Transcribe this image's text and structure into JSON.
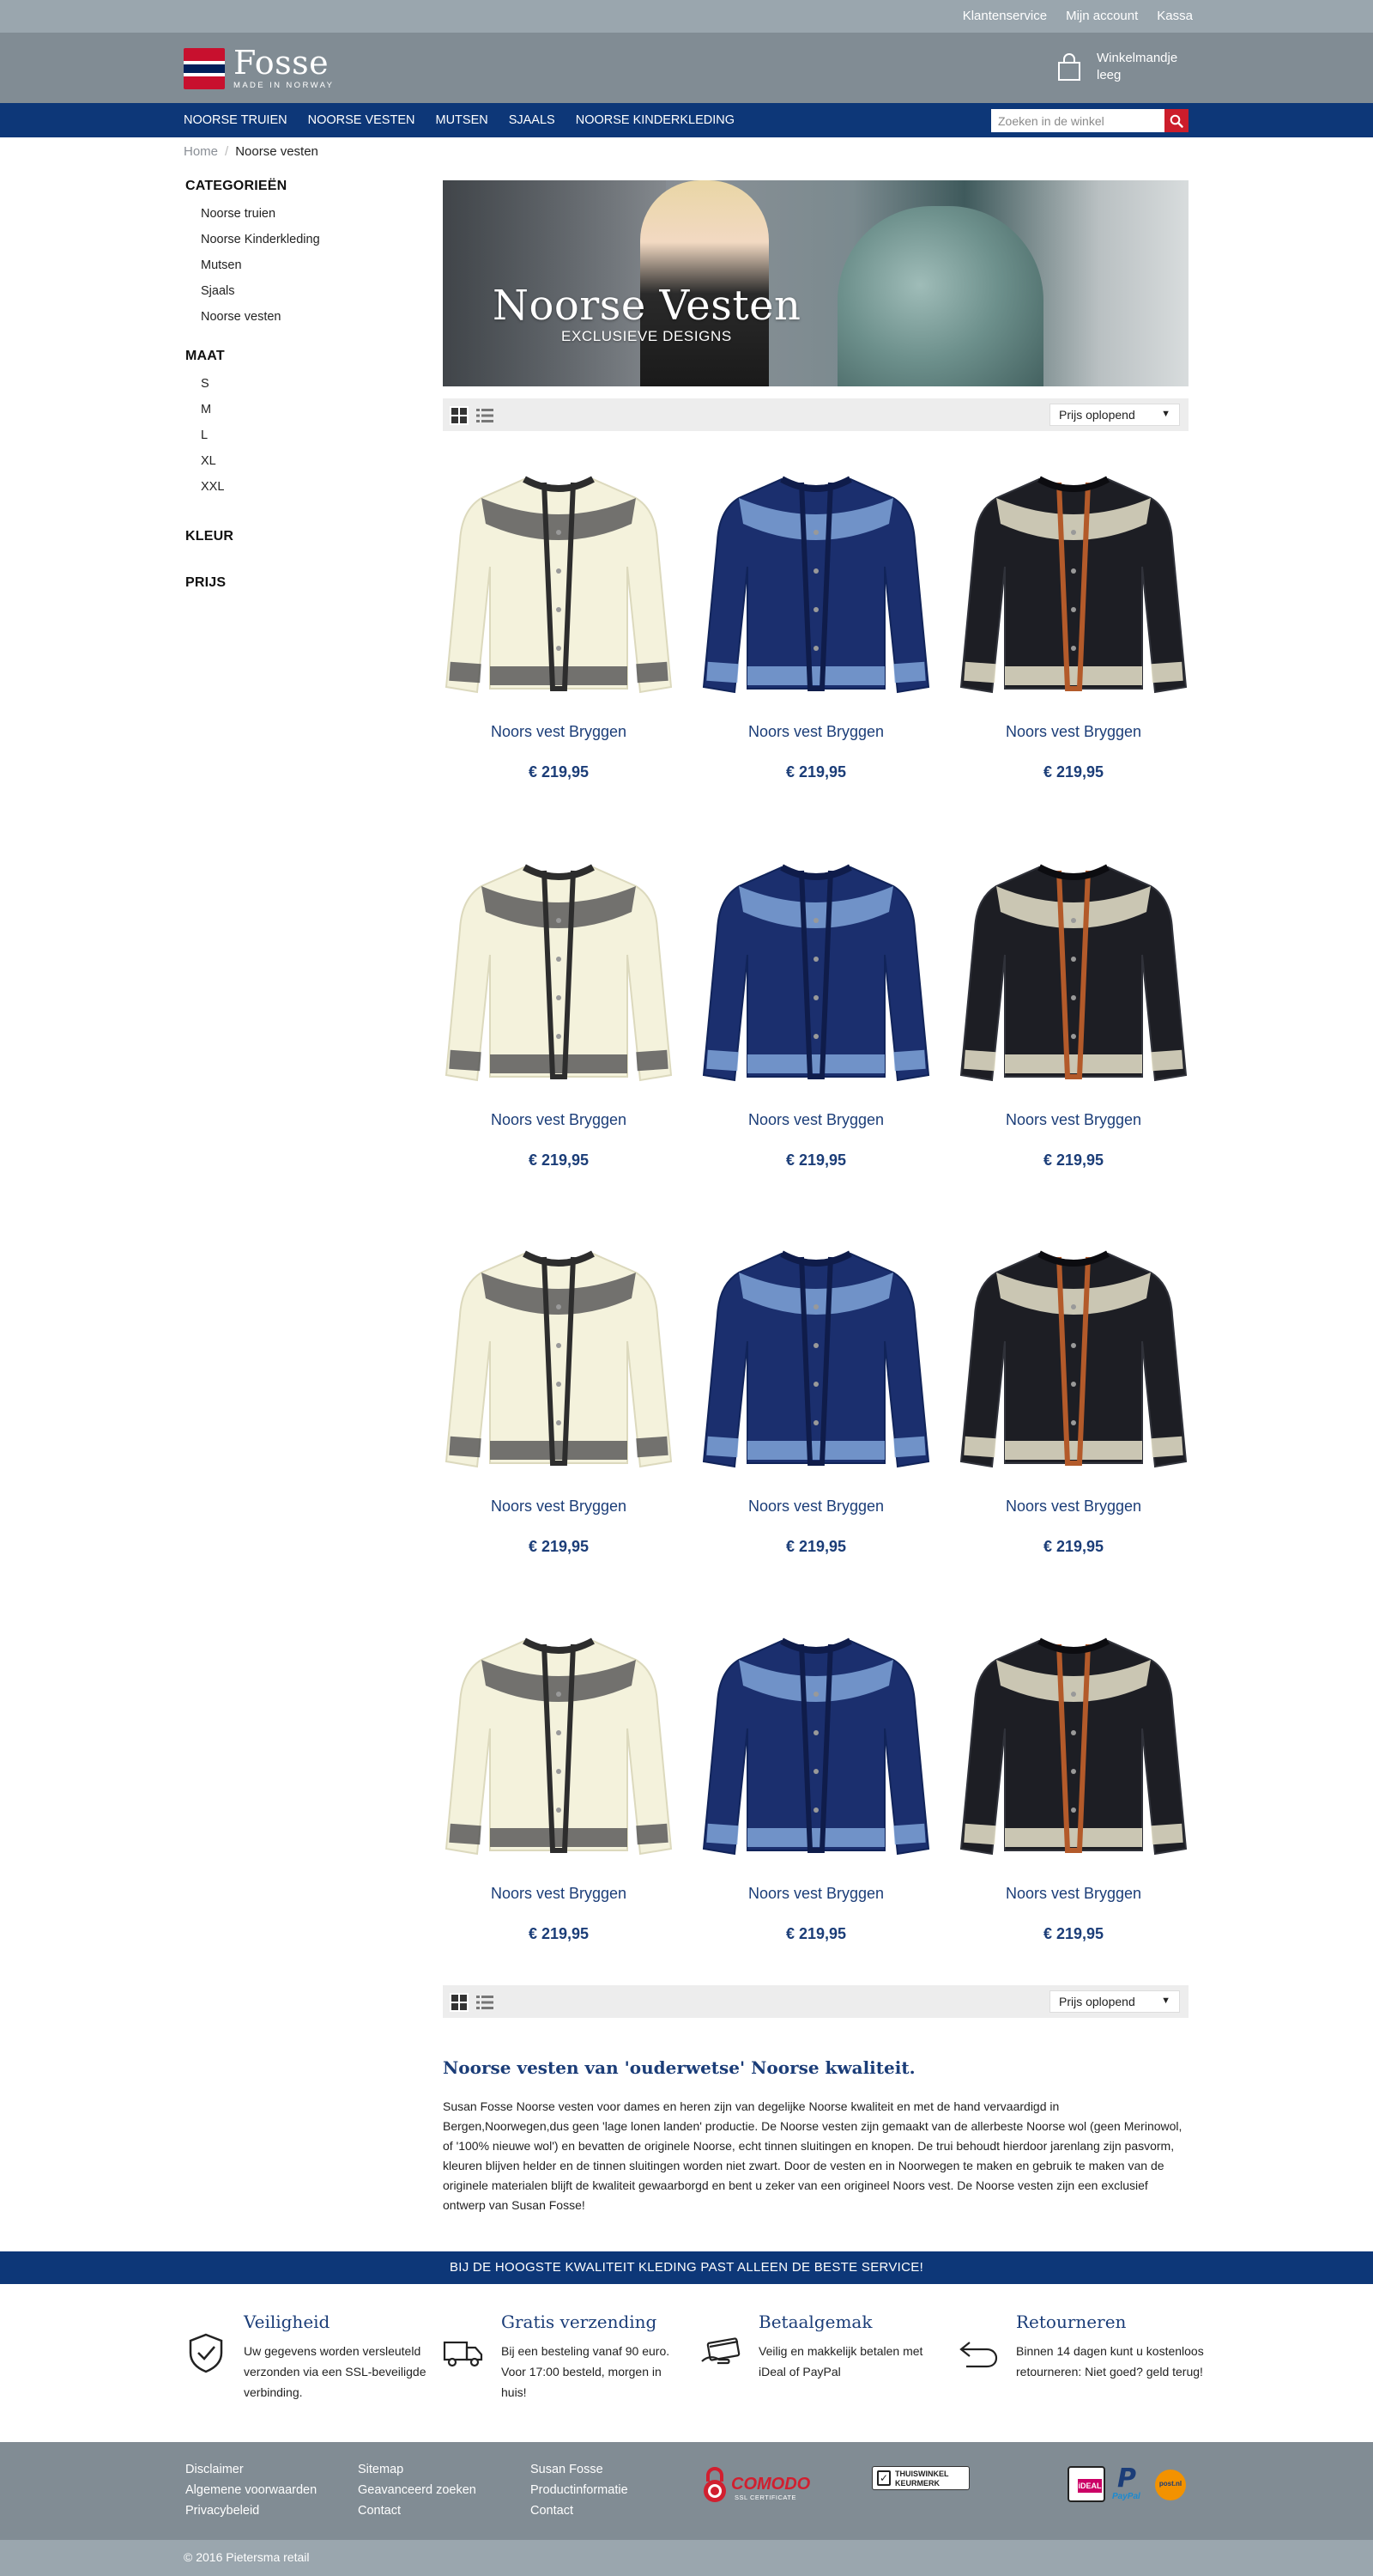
{
  "topbar": {
    "links": [
      "Klantenservice",
      "Mijn account",
      "Kassa"
    ]
  },
  "header": {
    "logo_name": "Fosse",
    "logo_sub": "MADE IN NORWAY",
    "cart_label": "Winkelmandje",
    "cart_status": "leeg"
  },
  "nav": {
    "items": [
      "NOORSE TRUIEN",
      "NOORSE VESTEN",
      "MUTSEN",
      "SJAALS",
      "NOORSE KINDERKLEDING"
    ],
    "search_placeholder": "Zoeken in de winkel"
  },
  "breadcrumb": {
    "home": "Home",
    "separator": "/",
    "current": "Noorse vesten"
  },
  "sidebar": {
    "categories_title": "CATEGORIEËN",
    "categories": [
      "Noorse truien",
      "Noorse Kinderkleding",
      "Mutsen",
      "Sjaals",
      "Noorse vesten"
    ],
    "size_title": "MAAT",
    "sizes": [
      "S",
      "M",
      "L",
      "XL",
      "XXL"
    ],
    "color_title": "KLEUR",
    "price_title": "PRIJS"
  },
  "banner": {
    "title": "Noorse Vesten",
    "subtitle": "EXCLUSIEVE DESIGNS"
  },
  "toolbar": {
    "sort_label": "Prijs oplopend"
  },
  "products": [
    {
      "name": "Noors vest Bryggen",
      "price": "€ 219,95",
      "style": "cream"
    },
    {
      "name": "Noors vest Bryggen",
      "price": "€ 219,95",
      "style": "blue"
    },
    {
      "name": "Noors vest Bryggen",
      "price": "€ 219,95",
      "style": "dark"
    },
    {
      "name": "Noors vest Bryggen",
      "price": "€ 219,95",
      "style": "cream"
    },
    {
      "name": "Noors vest Bryggen",
      "price": "€ 219,95",
      "style": "blue"
    },
    {
      "name": "Noors vest Bryggen",
      "price": "€ 219,95",
      "style": "dark"
    },
    {
      "name": "Noors vest Bryggen",
      "price": "€ 219,95",
      "style": "cream"
    },
    {
      "name": "Noors vest Bryggen",
      "price": "€ 219,95",
      "style": "blue"
    },
    {
      "name": "Noors vest Bryggen",
      "price": "€ 219,95",
      "style": "dark"
    },
    {
      "name": "Noors vest Bryggen",
      "price": "€ 219,95",
      "style": "cream"
    },
    {
      "name": "Noors vest Bryggen",
      "price": "€ 219,95",
      "style": "blue"
    },
    {
      "name": "Noors vest Bryggen",
      "price": "€ 219,95",
      "style": "dark"
    }
  ],
  "description": {
    "title": "Noorse vesten van 'ouderwetse' Noorse kwaliteit.",
    "text": "Susan Fosse Noorse vesten voor dames en heren zijn van degelijke Noorse kwaliteit en met de hand vervaardigd in Bergen,Noorwegen,dus geen 'lage lonen landen' productie. De Noorse vesten zijn gemaakt van de allerbeste Noorse wol (geen Merinowol, of '100% nieuwe wol') en bevatten de originele Noorse, echt tinnen sluitingen en knopen. De trui behoudt hierdoor jarenlang zijn pasvorm, kleuren blijven helder en de tinnen sluitingen worden niet zwart. Door de vesten en in Noorwegen te maken en gebruik te maken van de originele materialen blijft de kwaliteit gewaarborgd en bent u zeker van een origineel Noors vest. De Noorse vesten zijn een exclusief ontwerp van Susan Fosse!"
  },
  "strip": {
    "text": "BIJ DE HOOGSTE KWALITEIT KLEDING PAST ALLEEN DE BESTE SERVICE!"
  },
  "usps": [
    {
      "title": "Veiligheid",
      "text": "Uw gegevens worden versleuteld verzonden via een SSL-beveiligde verbinding.",
      "icon": "shield-check-icon"
    },
    {
      "title": "Gratis verzending",
      "text": "Bij een besteling vanaf 90 euro. Voor 17:00 besteld, morgen in huis!",
      "icon": "truck-icon"
    },
    {
      "title": "Betaalgemak",
      "text": "Veilig en makkelijk betalen met iDeal of PayPal",
      "icon": "card-hand-icon"
    },
    {
      "title": "Retourneren",
      "text": "Binnen 14 dagen kunt u kostenloos retourneren: Niet goed? geld terug!",
      "icon": "return-arrow-icon"
    }
  ],
  "footer": {
    "col1": [
      "Disclaimer",
      "Algemene voorwaarden",
      "Privacybeleid"
    ],
    "col2": [
      "Sitemap",
      "Geavanceerd zoeken",
      "Contact"
    ],
    "col3": [
      "Susan Fosse",
      "Productinformatie",
      "Contact"
    ],
    "comodo_name": "COMODO",
    "comodo_sub": "SSL CERTIFICATE",
    "keurmerk_top": "THUISWINKEL",
    "keurmerk_bottom": "KEURMERK",
    "ideal_label": "iDEAL",
    "paypal_label": "PayPal",
    "postnl_label": "post.nl",
    "copyright": "© 2016 Pietersma retail"
  },
  "colors": {
    "navy": "#0d3778",
    "header_gray": "#818c94",
    "topbar_gray": "#9aa6ae",
    "accent_red": "#cc1d2b",
    "link_blue": "#1b3d78"
  }
}
